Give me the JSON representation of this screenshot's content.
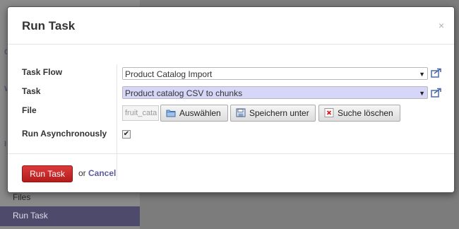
{
  "background": {
    "sidebar_letters": [
      "C",
      "W",
      "I"
    ],
    "files_label": "Files",
    "run_task_label": "Run Task"
  },
  "dialog": {
    "title": "Run Task",
    "close_glyph": "×"
  },
  "form": {
    "task_flow": {
      "label": "Task Flow",
      "value": "Product Catalog Import"
    },
    "task": {
      "label": "Task",
      "value": "Product catalog CSV to chunks"
    },
    "file": {
      "label": "File",
      "value": "fruit_cata",
      "buttons": {
        "choose": "Auswählen",
        "save_as": "Speichern unter",
        "clear_search": "Suche löschen"
      }
    },
    "run_async": {
      "label": "Run Asynchronously",
      "checked": true
    }
  },
  "footer": {
    "run_button": "Run Task",
    "or_text": "or",
    "cancel_link": "Cancel"
  },
  "colors": {
    "primary_button": "#c62828",
    "link": "#5b5b9f",
    "selected_option_bg": "#d6d6f8"
  }
}
